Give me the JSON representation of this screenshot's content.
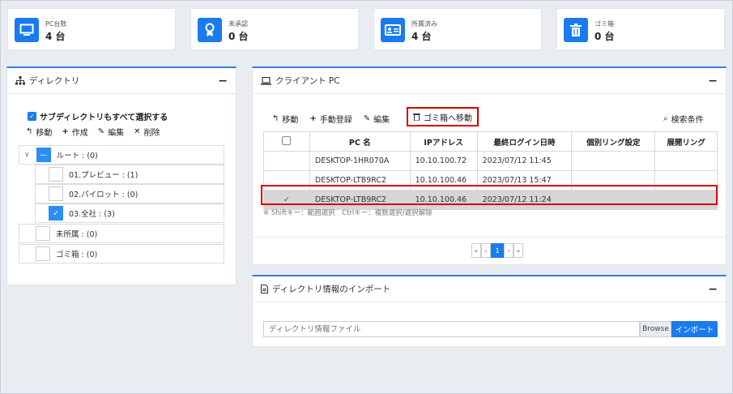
{
  "cards": [
    {
      "label": "PC台数",
      "value": "4 台",
      "icon": "monitor-icon"
    },
    {
      "label": "未承認",
      "value": "0 台",
      "icon": "award-icon"
    },
    {
      "label": "所属済み",
      "value": "4 台",
      "icon": "id-card-icon"
    },
    {
      "label": "ゴミ箱",
      "value": "0 台",
      "icon": "trash-icon"
    }
  ],
  "directory": {
    "title": "ディレクトリ",
    "collapse": "−",
    "select_all": "サブディレクトリもすべて選択する",
    "toolbar": {
      "move": "移動",
      "create": "作成",
      "edit": "編集",
      "delete": "削除"
    },
    "tree": [
      {
        "label": "ルート : (0)"
      },
      {
        "label": "01.プレビュー : (1)"
      },
      {
        "label": "02.パイロット : (0)"
      },
      {
        "label": "03.全社 : (3)"
      },
      {
        "label": "未所属 : (0)"
      },
      {
        "label": "ゴミ箱 : (0)"
      }
    ]
  },
  "client": {
    "title": "クライアント PC",
    "collapse": "−",
    "toolbar": {
      "move": "移動",
      "manual": "手動登録",
      "edit": "編集",
      "trash": "ゴミ箱へ移動",
      "search": "検索条件"
    },
    "columns": [
      "PC 名",
      "IPアドレス",
      "最終ログイン日時",
      "個別リング設定",
      "展開リング"
    ],
    "rows": [
      {
        "name": "DESKTOP-1HR070A",
        "ip": "10.10.100.72",
        "login": "2023/07/12 11:45",
        "ring": "",
        "deploy": ""
      },
      {
        "name": "DESKTOP-LTB9RC2",
        "ip": "10.10.100.46",
        "login": "2023/07/13 15:47",
        "ring": "",
        "deploy": ""
      },
      {
        "name": "DESKTOP-LTB9RC2",
        "ip": "10.10.100.46",
        "login": "2023/07/12 11:24",
        "ring": "",
        "deploy": ""
      }
    ],
    "hint": "※ Shiftキー：範囲選択　Ctrlキー：複数選択/選択解除",
    "pager": {
      "first": "«",
      "prev": "‹",
      "page": "1",
      "next": "›",
      "last": "»"
    }
  },
  "import": {
    "title": "ディレクトリ情報のインポート",
    "collapse": "−",
    "placeholder": "ディレクトリ情報ファイル",
    "browse": "Browse",
    "button": "インポート"
  },
  "colors": {
    "accent": "#1a7bef",
    "highlight": "#d40000",
    "selected_row": "#d6d6d6"
  }
}
